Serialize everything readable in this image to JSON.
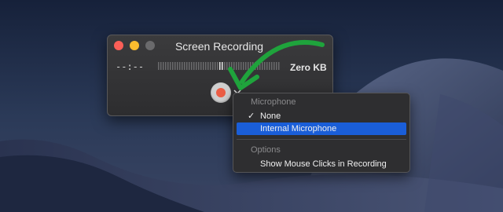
{
  "window": {
    "title": "Screen Recording",
    "timer": "--:--",
    "file_size": "Zero KB"
  },
  "options_menu": {
    "microphone_header": "Microphone",
    "microphone_items": [
      {
        "label": "None",
        "checked": true
      },
      {
        "label": "Internal Microphone",
        "highlighted": true
      }
    ],
    "options_header": "Options",
    "options_items": [
      {
        "label": "Show Mouse Clicks in Recording"
      }
    ]
  },
  "annotation": {
    "arrow_color": "#1fa33c"
  },
  "colors": {
    "record_dot": "#ec5d45",
    "highlight": "#1a5ed8",
    "close": "#fc5f57",
    "minimize": "#fdbc2e"
  },
  "icons": {
    "checkmark": "check-icon",
    "chevron": "chevron-down-icon",
    "record": "record-icon"
  }
}
